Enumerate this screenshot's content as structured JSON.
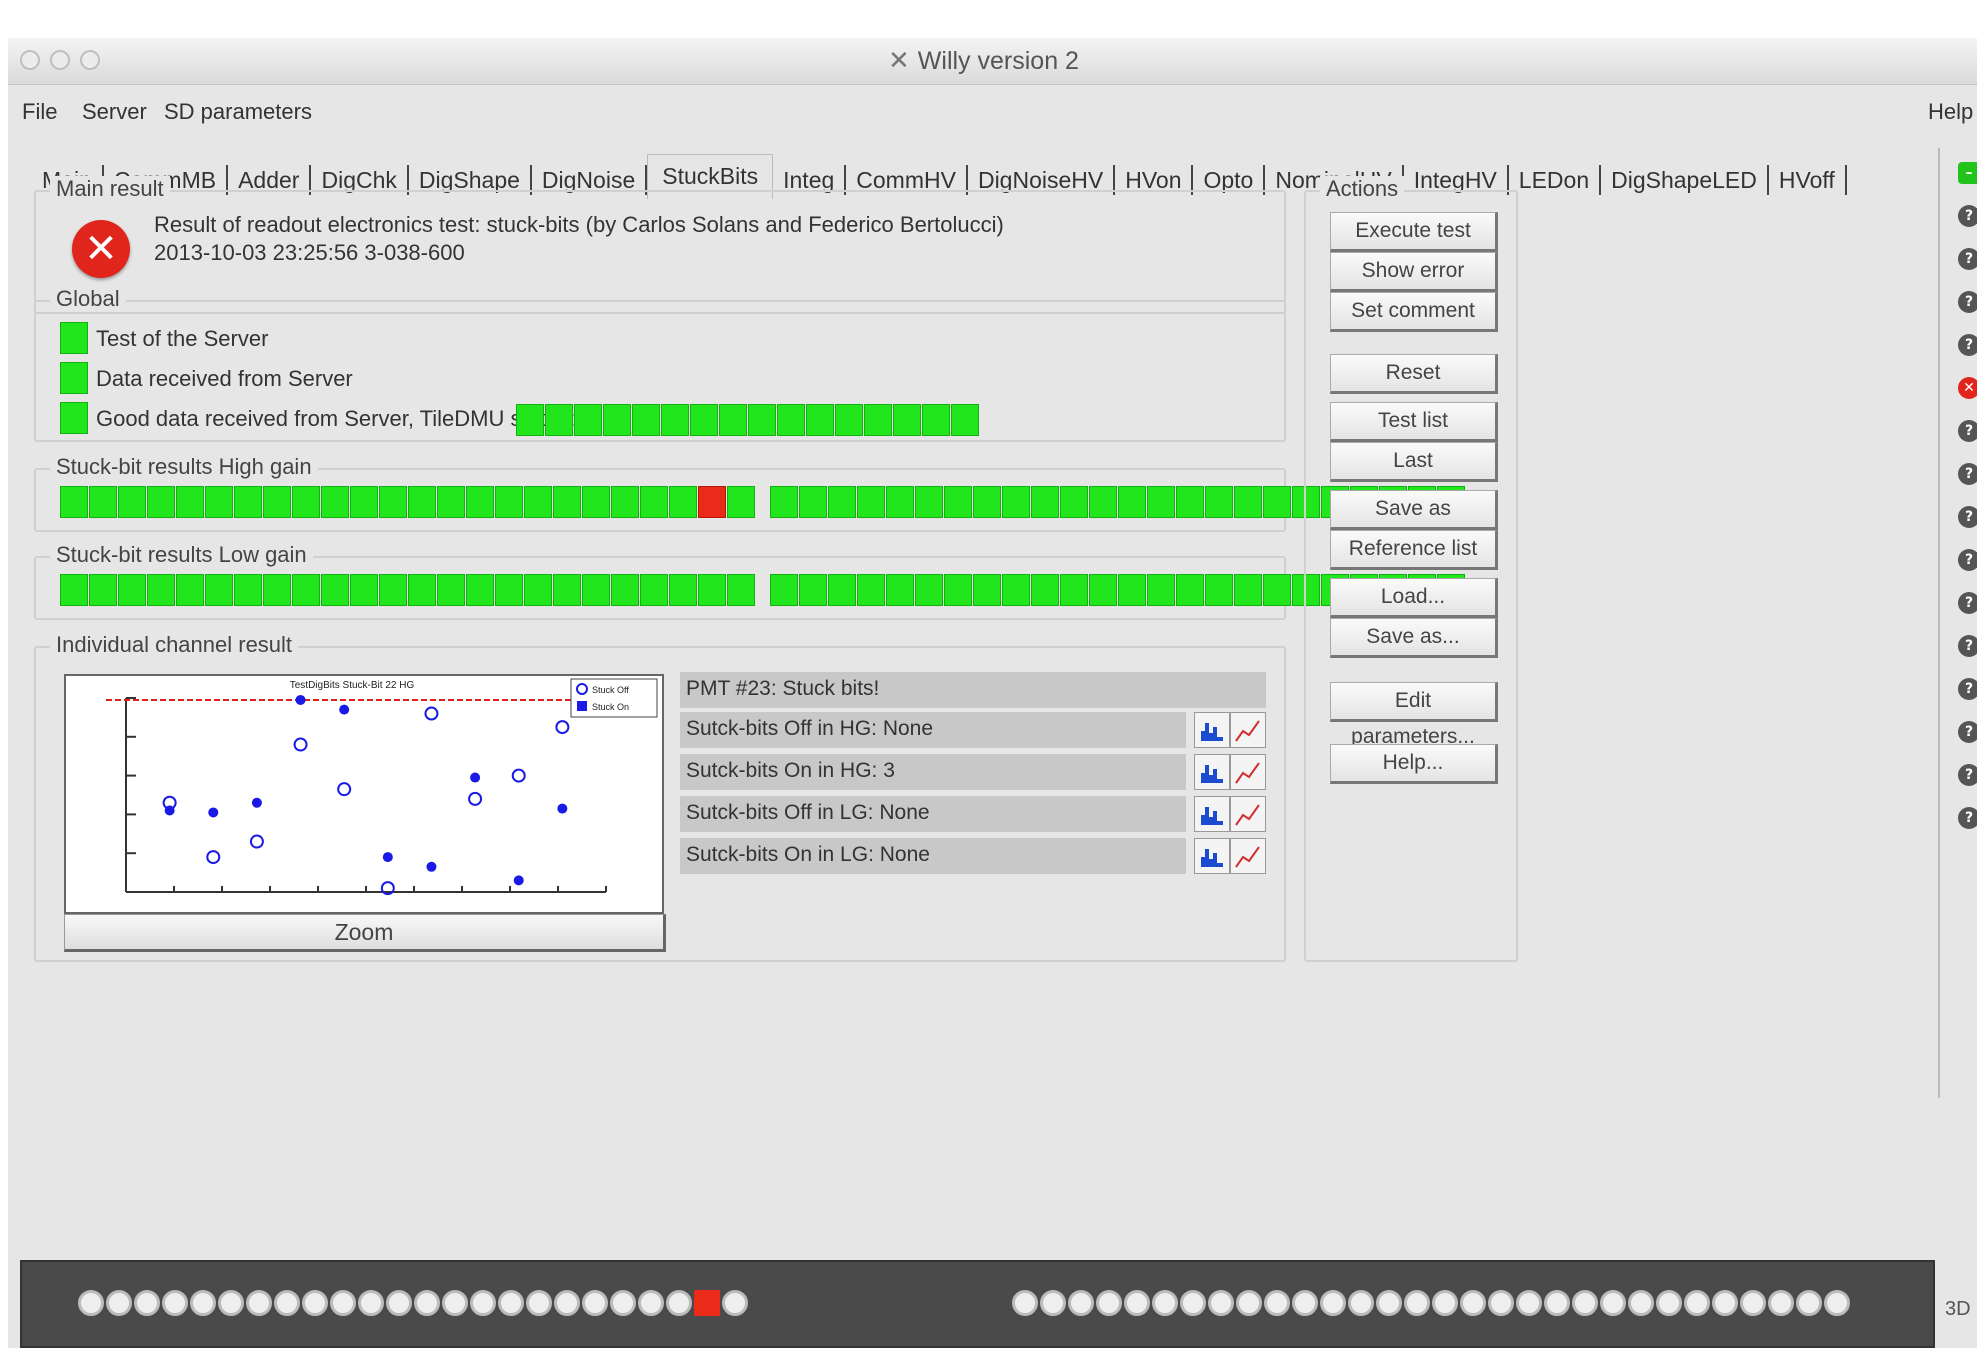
{
  "window": {
    "title": "Willy version 2"
  },
  "menu": {
    "file": "File",
    "server": "Server",
    "sd_parameters": "SD parameters",
    "help": "Help"
  },
  "tabs": [
    "Main",
    "CommMB",
    "Adder",
    "DigChk",
    "DigShape",
    "DigNoise",
    "StuckBits",
    "Integ",
    "CommHV",
    "DigNoiseHV",
    "HVon",
    "Opto",
    "NominalHV",
    "IntegHV",
    "LEDon",
    "DigShapeLED",
    "HVoff"
  ],
  "active_tab": "StuckBits",
  "main_result": {
    "legend": "Main result",
    "status": "error",
    "line1": "Result of readout electronics test: stuck-bits (by Carlos Solans and Federico Bertolucci)",
    "line2": "2013-10-03 23:25:56   3-038-600"
  },
  "global": {
    "legend": "Global",
    "items": [
      "Test of the Server",
      "Data received from Server",
      "Good data received from Server, TileDMU status:"
    ],
    "tiledmu_count": 16
  },
  "high_gain": {
    "legend": "Stuck-bit results High gain",
    "left_count": 24,
    "right_count": 24,
    "bad_index": 22
  },
  "low_gain": {
    "legend": "Stuck-bit results Low gain",
    "left_count": 24,
    "right_count": 24
  },
  "individual": {
    "legend": "Individual channel result",
    "zoom_label": "Zoom",
    "pmt_title": "PMT #23: Stuck bits!",
    "fields": [
      "Sutck-bits Off in HG: None",
      "Sutck-bits On in HG: 3",
      "Sutck-bits Off in LG: None",
      "Sutck-bits On in LG: None"
    ]
  },
  "actions": {
    "legend": "Actions",
    "buttons": [
      "Execute test",
      "Show error",
      "Set comment",
      "Reset",
      "Test list",
      "Last",
      "Save as reference",
      "Reference list",
      "Load...",
      "Save as...",
      "Edit parameters...",
      "Help..."
    ]
  },
  "chart_data": {
    "type": "scatter",
    "title": "TestDigBits Stuck-Bit 22 HG",
    "series": [
      {
        "name": "Stuck Off",
        "marker": "open-circle",
        "points": [
          [
            1,
            4.6
          ],
          [
            2,
            1.8
          ],
          [
            3,
            2.6
          ],
          [
            4,
            7.6
          ],
          [
            5,
            5.3
          ],
          [
            6,
            0.2
          ],
          [
            7,
            9.2
          ],
          [
            8,
            4.8
          ],
          [
            9,
            6.0
          ],
          [
            10,
            8.5
          ]
        ]
      },
      {
        "name": "Stuck On",
        "marker": "filled-circle",
        "points": [
          [
            1,
            4.2
          ],
          [
            2,
            4.1
          ],
          [
            3,
            4.6
          ],
          [
            4,
            9.9
          ],
          [
            5,
            9.4
          ],
          [
            6,
            1.8
          ],
          [
            7,
            1.3
          ],
          [
            8,
            5.9
          ],
          [
            9,
            0.6
          ],
          [
            10,
            4.3
          ]
        ]
      }
    ],
    "threshold": 9.9,
    "xlim": [
      0,
      11
    ],
    "ylim": [
      0,
      10
    ],
    "colors": {
      "points": "#1a1ae6",
      "threshold": "#e02020"
    }
  },
  "status_strip": {
    "label": "3D",
    "icons": 16
  }
}
